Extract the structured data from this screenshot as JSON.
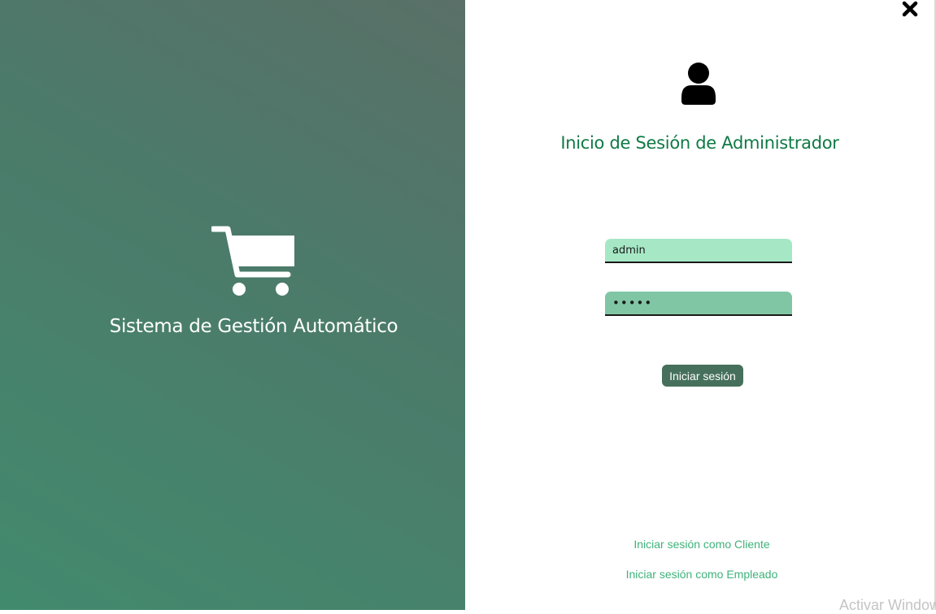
{
  "brand": {
    "title": "Sistema de Gestión Automático",
    "icon": "shopping-cart-icon"
  },
  "login": {
    "icon": "user-icon",
    "title": "Inicio de Sesión de Administrador",
    "username_value": "admin",
    "password_value": "•••••",
    "submit_label": "Iniciar sesión"
  },
  "links": {
    "client": "Iniciar sesión como Cliente",
    "employee": "Iniciar sesión como Empleado"
  },
  "window": {
    "close_icon": "close-icon"
  },
  "watermark": "Activar Windows",
  "colors": {
    "left_panel_start": "#5a7068",
    "left_panel_end": "#428a6e",
    "title_green": "#0f7a45",
    "username_bg": "#a6e8c6",
    "password_bg": "#80c6a4",
    "button_bg": "#46705c",
    "link_green": "#3fb27a"
  }
}
